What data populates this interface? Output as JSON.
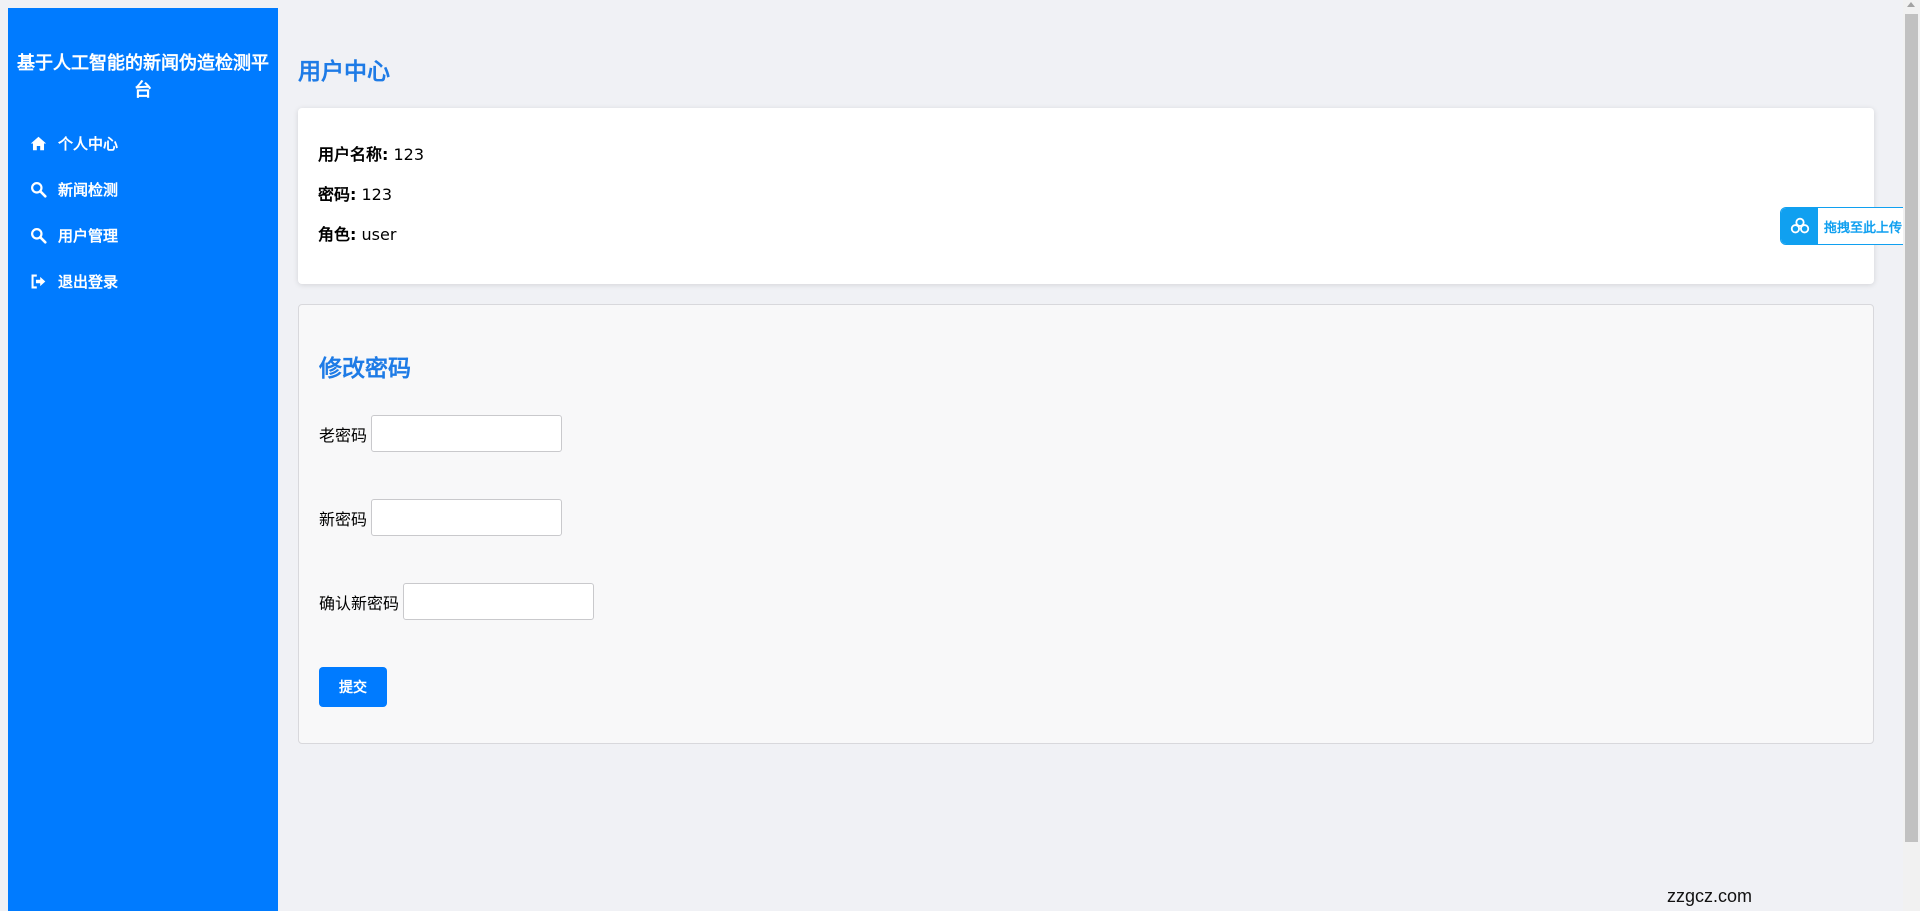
{
  "app": {
    "title": "基于人工智能的新闻伪造检测平台"
  },
  "sidebar": {
    "items": [
      {
        "label": "个人中心",
        "icon": "home-icon"
      },
      {
        "label": "新闻检测",
        "icon": "search-icon"
      },
      {
        "label": "用户管理",
        "icon": "search-icon"
      },
      {
        "label": "退出登录",
        "icon": "sign-out-icon"
      }
    ]
  },
  "page": {
    "title": "用户中心"
  },
  "profile": {
    "username_label": "用户名称:",
    "username_value": "123",
    "password_label": "密码:",
    "password_value": "123",
    "role_label": "角色:",
    "role_value": "user"
  },
  "change_password": {
    "title": "修改密码",
    "old_label": "老密码",
    "old_value": "",
    "new_label": "新密码",
    "new_value": "",
    "confirm_label": "确认新密码",
    "confirm_value": "",
    "submit_label": "提交"
  },
  "upload_widget": {
    "label": "拖拽至此上传"
  },
  "watermark": {
    "text": "zzgcz.com"
  },
  "colors": {
    "sidebar": "#007bff",
    "accent": "#1e7be6",
    "upload": "#10a0f0"
  }
}
